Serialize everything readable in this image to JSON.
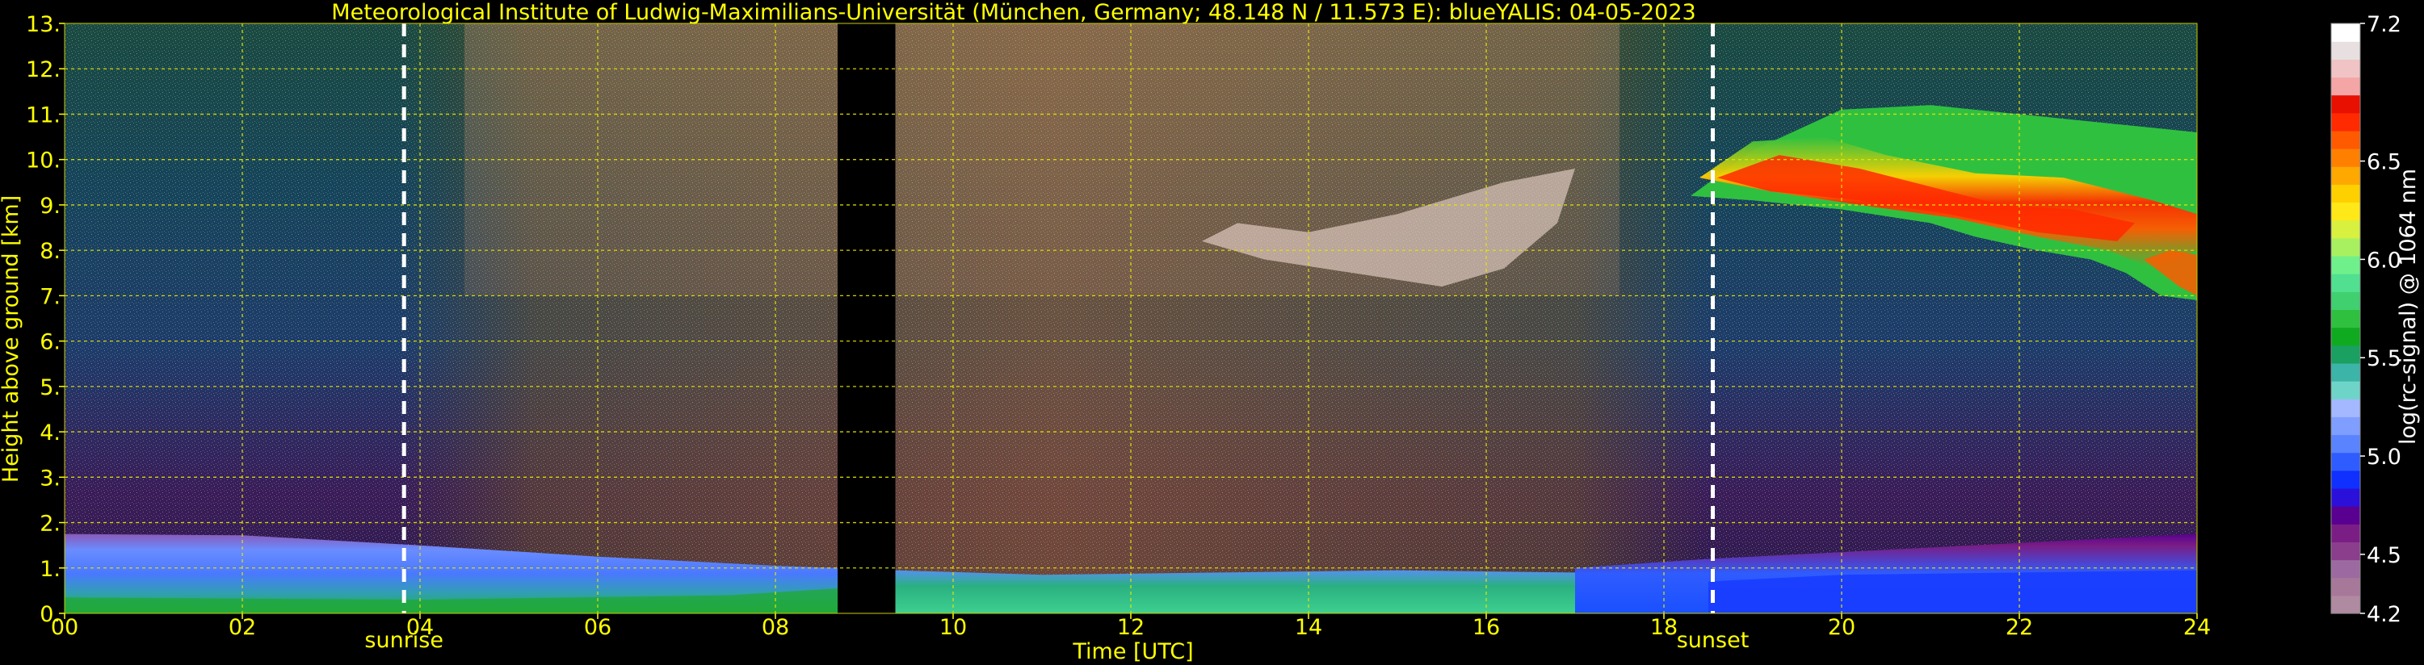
{
  "chart_data": {
    "type": "heatmap",
    "title": "Meteorological Institute of Ludwig-Maximilians-Universität (München, Germany; 48.148 N / 11.573 E):     blueYALIS: 04-05-2023",
    "xlabel": "Time [UTC]",
    "ylabel": "Height above ground [km]",
    "colorbar_label": "log(rc-signal) @ 1064 nm",
    "xlim": [
      0,
      24
    ],
    "ylim": [
      0,
      13
    ],
    "x_ticks": [
      "00",
      "02",
      "04",
      "06",
      "08",
      "10",
      "12",
      "14",
      "16",
      "18",
      "20",
      "22",
      "24"
    ],
    "x_tick_values": [
      0,
      2,
      4,
      6,
      8,
      10,
      12,
      14,
      16,
      18,
      20,
      22,
      24
    ],
    "y_ticks": [
      "0.",
      "1.",
      "2.",
      "3.",
      "4.",
      "5.",
      "6.",
      "7.",
      "8.",
      "9.",
      "10.",
      "11.",
      "12.",
      "13."
    ],
    "y_tick_values": [
      0,
      1,
      2,
      3,
      4,
      5,
      6,
      7,
      8,
      9,
      10,
      11,
      12,
      13
    ],
    "grid": true,
    "colorbar": {
      "min": 4.2,
      "max": 7.2,
      "ticks": [
        "4.2",
        "4.5",
        "5.0",
        "5.5",
        "6.0",
        "6.5",
        "7.2"
      ],
      "tick_values": [
        4.2,
        4.5,
        5.0,
        5.5,
        6.0,
        6.5,
        7.2
      ],
      "colors": [
        "#b08aa0",
        "#a8789a",
        "#9c6aa0",
        "#8a3e8c",
        "#7a1e86",
        "#5a0090",
        "#2a10d8",
        "#1030ff",
        "#2f5cff",
        "#5a84ff",
        "#7f9eff",
        "#a4b8ff",
        "#6fd4c8",
        "#3cb4a8",
        "#1aa060",
        "#10aa20",
        "#30c040",
        "#40d070",
        "#50e090",
        "#70f08a",
        "#a8f060",
        "#d8f040",
        "#ffe818",
        "#ffd000",
        "#ffa800",
        "#ff8000",
        "#ff5a00",
        "#ff2a00",
        "#e81000",
        "#f4a6a6",
        "#f0c4c4",
        "#e8e0e0",
        "#ffffff"
      ]
    },
    "markers": [
      {
        "label": "sunrise",
        "x": 3.82
      },
      {
        "label": "sunset",
        "x": 18.55
      }
    ],
    "no_data_intervals": [
      [
        8.7,
        9.35
      ]
    ],
    "features": [
      {
        "label": "low aerosol layer",
        "x": [
          0,
          24
        ],
        "y": [
          0,
          1.8
        ]
      },
      {
        "label": "cirrus cloud",
        "x": [
          12.8,
          17.0
        ],
        "y": [
          7.2,
          10.0
        ]
      },
      {
        "label": "cirrus cloud",
        "x": [
          18.0,
          24.0
        ],
        "y": [
          7.0,
          11.3
        ]
      }
    ]
  }
}
